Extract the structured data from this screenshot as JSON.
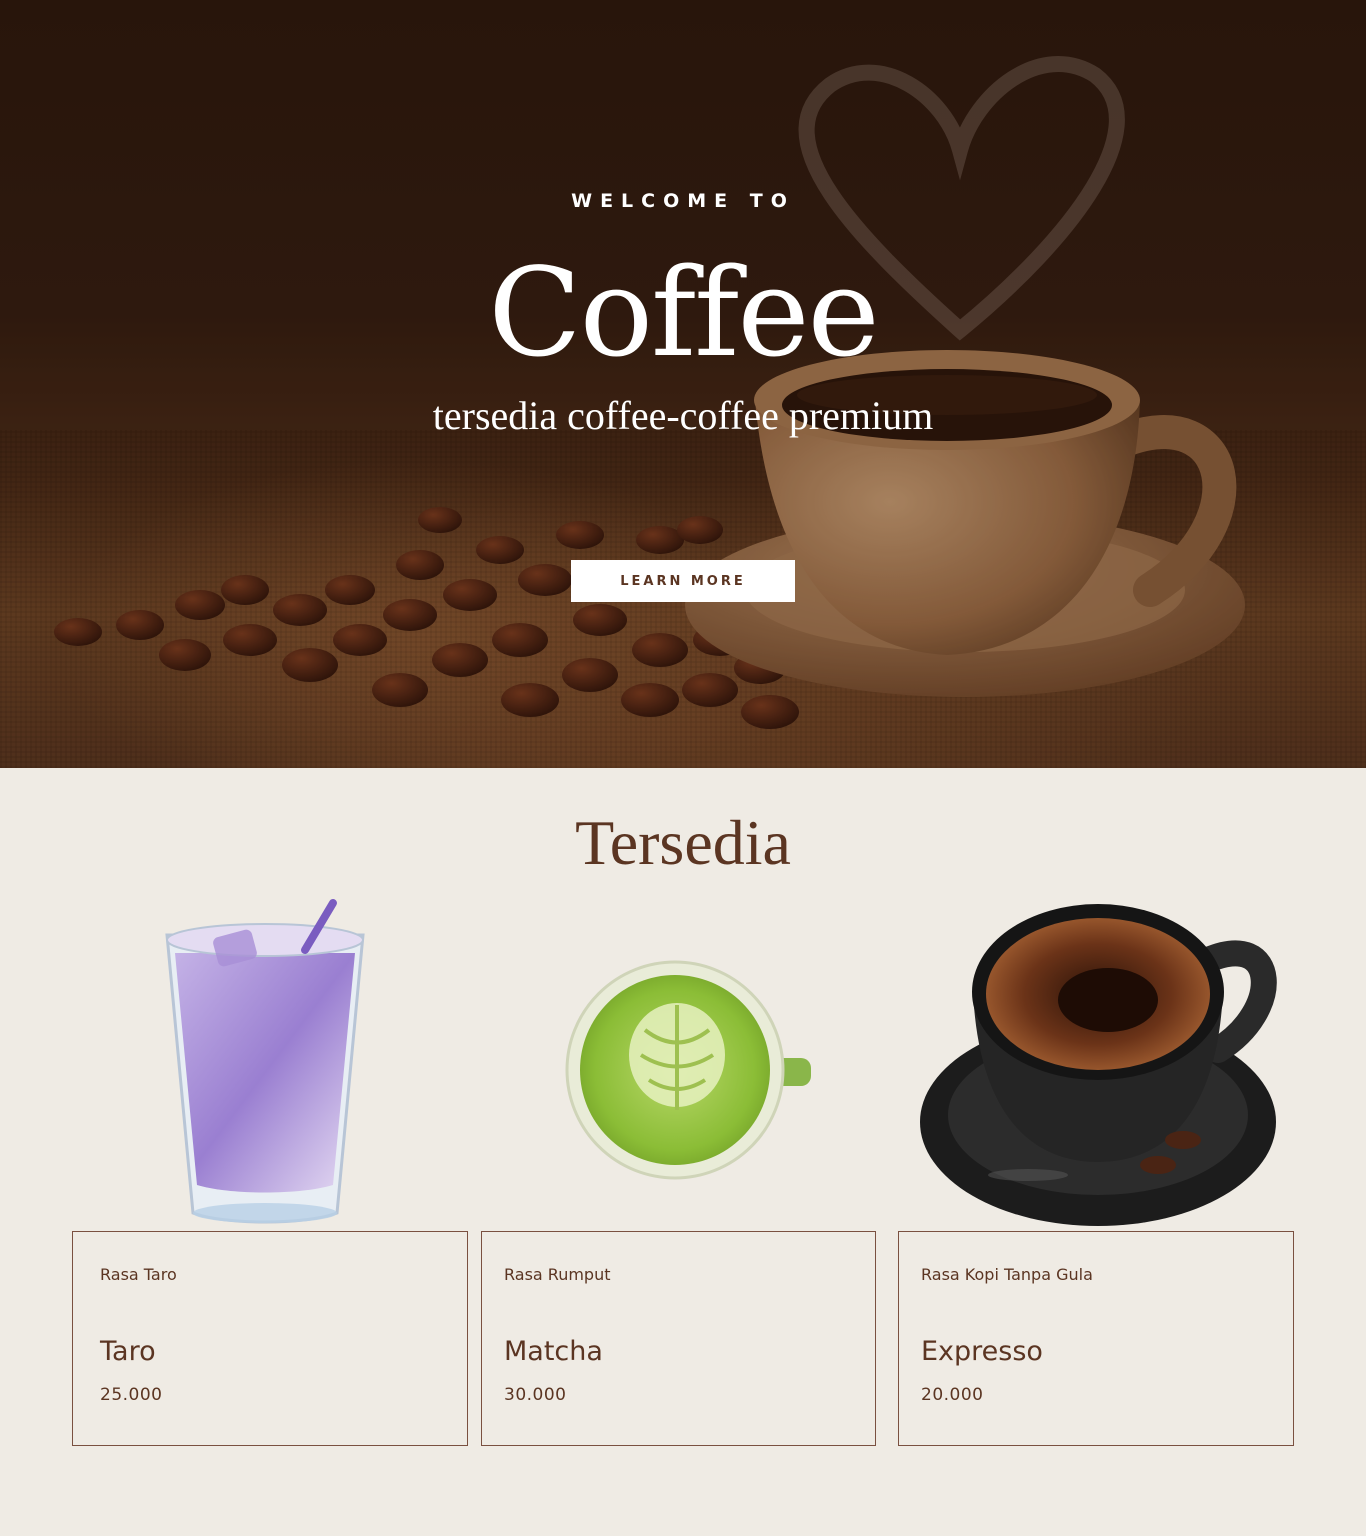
{
  "hero": {
    "welcome": "WELCOME TO",
    "title": "Coffee",
    "subtitle": "tersedia coffee-coffee premium",
    "button_label": "LEARN MORE"
  },
  "section": {
    "title": "Tersedia"
  },
  "products": [
    {
      "description": "Rasa Taro",
      "name": "Taro",
      "price": "25.000",
      "image": "taro-drink-icon"
    },
    {
      "description": "Rasa Rumput",
      "name": "Matcha",
      "price": "30.000",
      "image": "matcha-cup-icon"
    },
    {
      "description": "Rasa Kopi Tanpa Gula",
      "name": "Expresso",
      "price": "20.000",
      "image": "espresso-cup-icon"
    }
  ],
  "colors": {
    "brand_brown": "#5b3522",
    "page_background": "#efebe4",
    "hero_dark": "#2b170d",
    "button_background": "#ffffff"
  }
}
